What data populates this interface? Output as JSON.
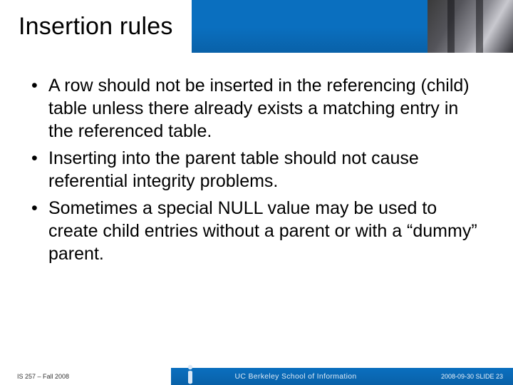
{
  "title": "Insertion rules",
  "bullets": [
    "A row should not be inserted in the referencing (child) table unless there already exists a matching entry in the referenced table.",
    "Inserting into the parent table should not cause referential integrity problems.",
    "Sometimes a special NULL value may be used to create child entries without a parent or with a “dummy” parent."
  ],
  "footer": {
    "course": "IS 257 – Fall 2008",
    "school_prefix": "UC Berkeley",
    "school_suffix": "School of Information",
    "date_slide": "2008-09-30  SLIDE 23"
  }
}
